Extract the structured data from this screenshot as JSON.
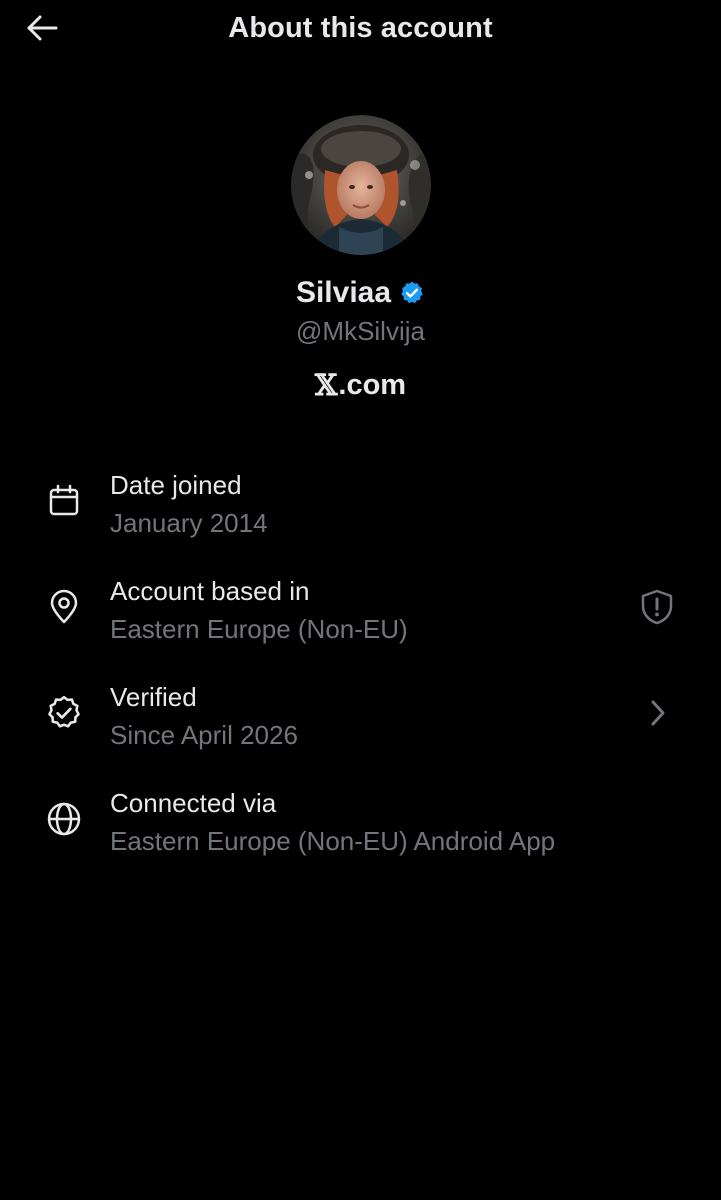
{
  "header": {
    "title": "About this account",
    "back_icon": "arrow-left-icon"
  },
  "profile": {
    "display_name": "Silviaa",
    "handle": "@MkSilvija",
    "verified_badge_color": "#1d9bf0",
    "site_logo": "𝕏",
    "site_suffix": ".com"
  },
  "details": [
    {
      "icon": "calendar-icon",
      "title": "Date joined",
      "value": "January 2014"
    },
    {
      "icon": "location-pin-icon",
      "title": "Account based in",
      "value": "Eastern Europe (Non-EU)",
      "trailing_icon": "shield-alert-icon"
    },
    {
      "icon": "verified-outline-icon",
      "title": "Verified",
      "value": "Since April 2026",
      "trailing_icon": "chevron-right-icon"
    },
    {
      "icon": "globe-icon",
      "title": "Connected via",
      "value": "Eastern Europe (Non-EU) Android App"
    }
  ],
  "colors": {
    "background": "#000000",
    "primary_text": "#e7e9ea",
    "secondary_text": "#71767b",
    "accent": "#1d9bf0"
  }
}
